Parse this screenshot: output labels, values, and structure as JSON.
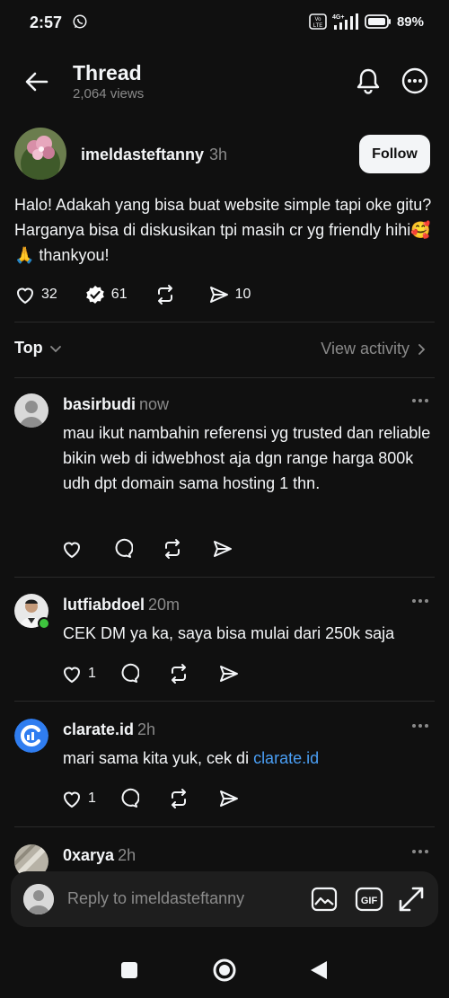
{
  "status_bar": {
    "time": "2:57",
    "network": "4G+",
    "volte": "Vo LTE",
    "battery": "89%"
  },
  "header": {
    "title": "Thread",
    "views": "2,064 views"
  },
  "post": {
    "author": "imeldasteftanny",
    "time": "3h",
    "follow_label": "Follow",
    "text": "Halo! Adakah yang bisa buat website simple tapi oke gitu? Harganya bisa di diskusikan tpi masih cr yg friendly hihi🥰🙏 thankyou!",
    "likes": "32",
    "reposts": "61",
    "shares": "10"
  },
  "sort": {
    "label": "Top",
    "view_activity": "View activity"
  },
  "replies": [
    {
      "author": "basirbudi",
      "time": "now",
      "text": "mau ikut nambahin referensi yg trusted dan reliable bikin web di idwebhost aja dgn range harga 800k udh dpt domain sama hosting 1 thn.",
      "likes": ""
    },
    {
      "author": "lutfiabdoel",
      "time": "20m",
      "text": "CEK DM ya ka, saya bisa mulai dari 250k saja",
      "likes": "1"
    },
    {
      "author": "clarate.id",
      "time": "2h",
      "text": "mari sama kita yuk, cek di ",
      "link": "clarate.id",
      "likes": "1"
    },
    {
      "author": "0xarya",
      "time": "2h"
    }
  ],
  "composer": {
    "placeholder": "Reply to imeldasteftanny"
  },
  "colors": {
    "background": "#101010",
    "text": "#f3f5f7",
    "muted": "#8a8a8a",
    "link": "#4a9ff5",
    "verified_badge": "#ffffff"
  }
}
